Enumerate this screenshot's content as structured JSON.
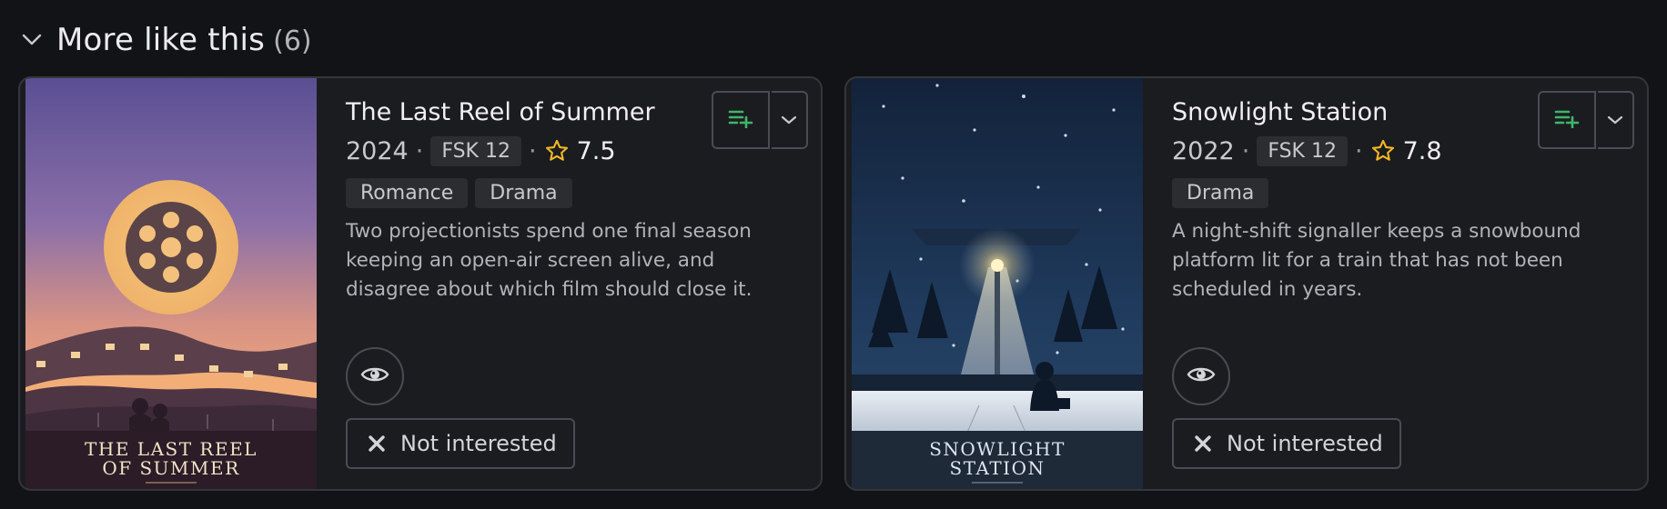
{
  "section": {
    "title": "More like this",
    "count": "(6)"
  },
  "cards": [
    {
      "title": "The Last Reel of Summer",
      "year": "2024",
      "sep": "·",
      "fsk": "FSK 12",
      "rating": "7.5",
      "genres": [
        "Romance",
        "Drama"
      ],
      "description": "Two projectionists spend one final season keeping an open-air screen alive, and disagree about which film should close it.",
      "poster_title_line1": "THE LAST REEL",
      "poster_title_line2": "OF SUMMER",
      "not_interested_label": "Not interested"
    },
    {
      "title": "Snowlight Station",
      "year": "2022",
      "sep": "·",
      "fsk": "FSK 12",
      "rating": "7.8",
      "genres": [
        "Drama"
      ],
      "description": "A night-shift signaller keeps a snowbound platform lit for a train that has not been scheduled in years.",
      "poster_title_line1": "SNOWLIGHT",
      "poster_title_line2": "STATION",
      "not_interested_label": "Not interested"
    }
  ],
  "icons": {
    "collapse": "chevron-down-icon",
    "watchlist": "playlist-add-icon",
    "more": "chevron-down-icon",
    "watched": "eye-icon",
    "not_interested": "close-icon",
    "rating": "star-icon"
  },
  "colors": {
    "accent_green": "#3fb56b",
    "star_gold": "#f2b824",
    "background": "#121316",
    "card": "#1b1c1f"
  }
}
